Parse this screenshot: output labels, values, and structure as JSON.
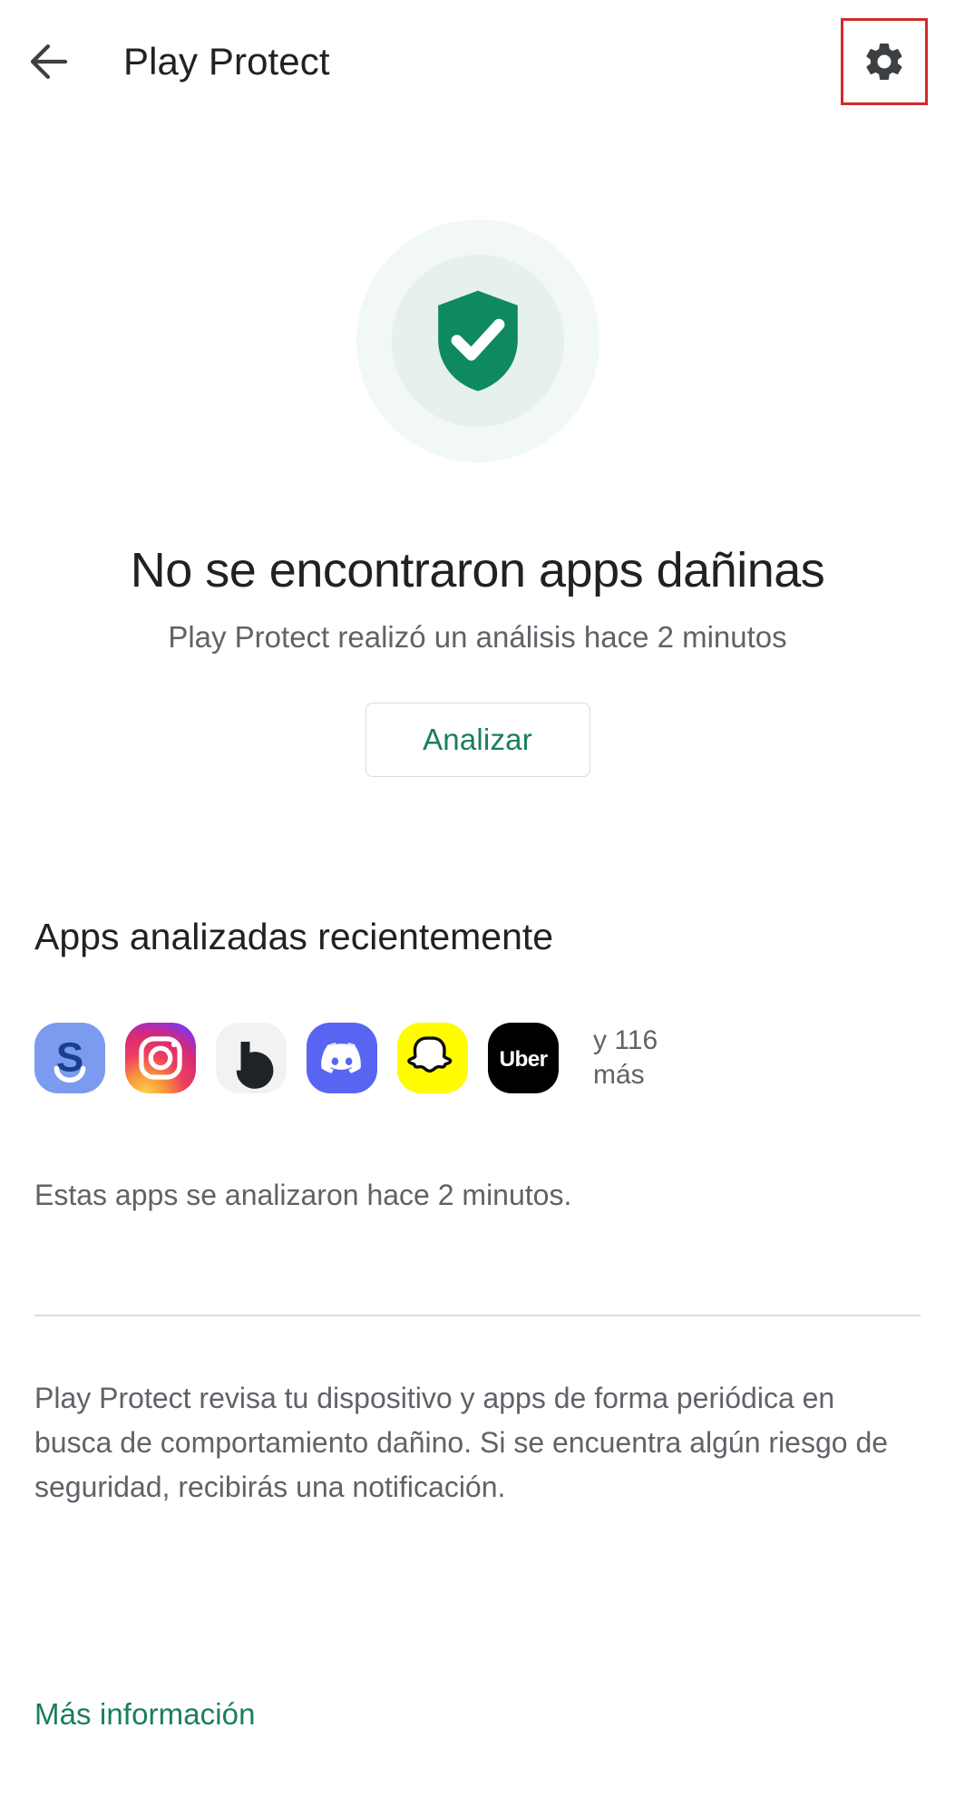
{
  "appbar": {
    "back_icon": "arrow-left-icon",
    "title": "Play Protect",
    "settings_icon": "gear-icon",
    "highlight_color": "#d32a2a"
  },
  "hero": {
    "icon": "shield-check-icon",
    "shield_color": "#0f8a5f",
    "ring_outer_color": "#f2f8f5",
    "ring_inner_color": "#e6f1ec"
  },
  "status": {
    "title": "No se encontraron apps dañinas",
    "subtitle": "Play Protect realizó un análisis hace 2 minutos",
    "scan_button": "Analizar",
    "accent_color": "#1a7f5a"
  },
  "recent": {
    "heading": "Apps analizadas recientemente",
    "apps": [
      {
        "name": "samsung-s-app-icon",
        "label": "S",
        "bg": "#7b9bf0",
        "fg": "#1a3f8f"
      },
      {
        "name": "instagram-app-icon",
        "label": "Instagram",
        "bg": "#d62976",
        "fg": "#ffffff"
      },
      {
        "name": "bixby-app-icon",
        "label": "b",
        "bg": "#f2f2f2",
        "fg": "#1f2328"
      },
      {
        "name": "discord-app-icon",
        "label": "Discord",
        "bg": "#5865f2",
        "fg": "#ffffff"
      },
      {
        "name": "snapchat-app-icon",
        "label": "Snapchat",
        "bg": "#fffc00",
        "fg": "#ffffff"
      },
      {
        "name": "uber-app-icon",
        "label": "Uber",
        "bg": "#000000",
        "fg": "#ffffff"
      }
    ],
    "more_count": "y 116 más",
    "scanned_note": "Estas apps se analizaron hace 2 minutos."
  },
  "footer": {
    "description": "Play Protect revisa tu dispositivo y apps de forma periódica en busca de comportamiento dañino. Si se encuentra algún riesgo de seguridad, recibirás una notificación.",
    "learn_more": "Más información"
  }
}
